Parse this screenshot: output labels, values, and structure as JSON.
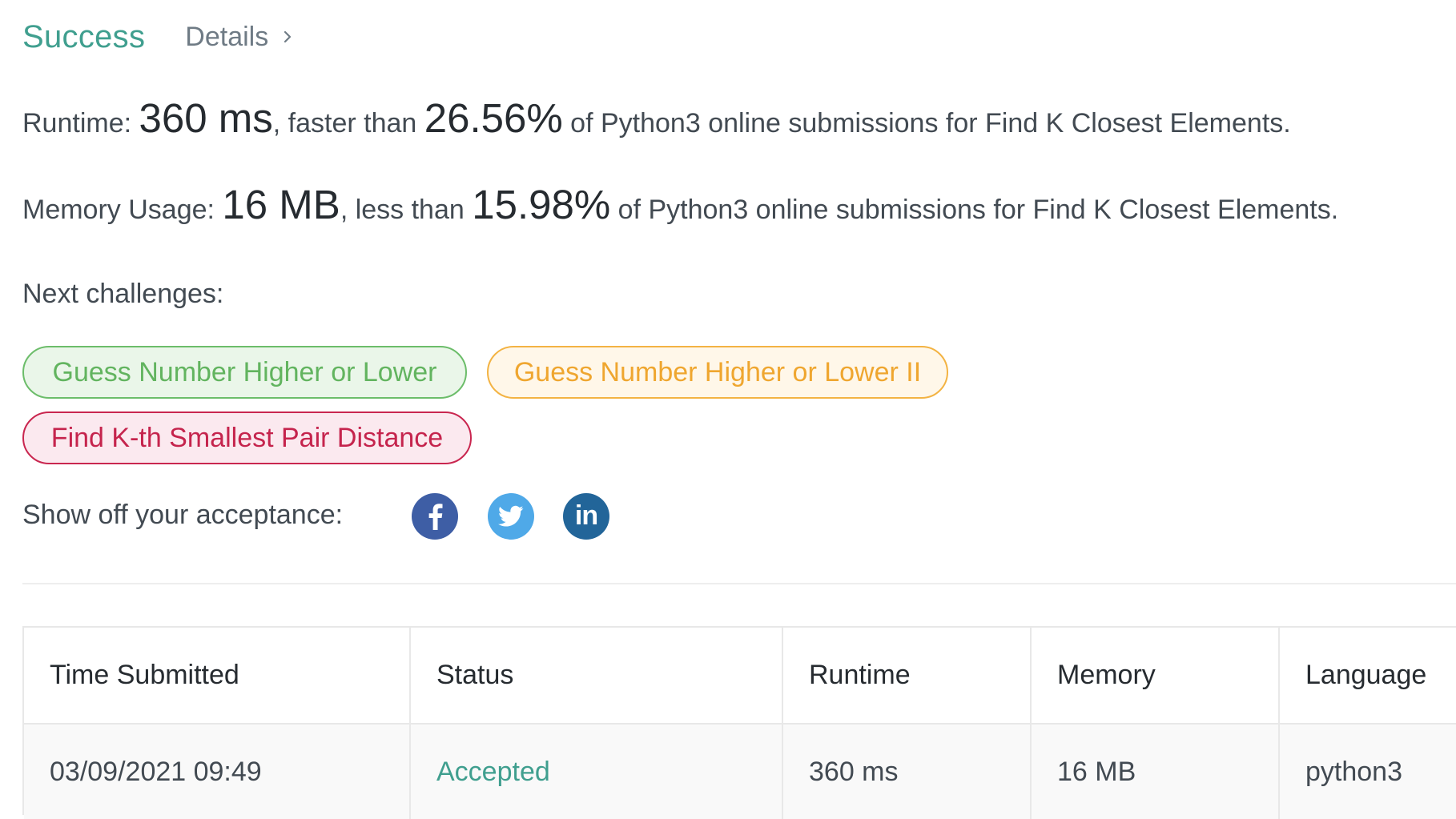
{
  "header": {
    "status": "Success",
    "details_label": "Details"
  },
  "runtime": {
    "label": "Runtime: ",
    "value": "360 ms",
    "comparison": ", faster than ",
    "percent": "26.56%",
    "suffix": " of Python3 online submissions for Find K Closest Elements."
  },
  "memory": {
    "label": "Memory Usage: ",
    "value": "16 MB",
    "comparison": ", less than ",
    "percent": "15.98%",
    "suffix": " of Python3 online submissions for Find K Closest Elements."
  },
  "next": {
    "title": "Next challenges:",
    "challenges": [
      {
        "label": "Guess Number Higher or Lower",
        "difficulty": "easy",
        "color": "#62b45f"
      },
      {
        "label": "Guess Number Higher or Lower II",
        "difficulty": "medium",
        "color": "#efa62f"
      },
      {
        "label": "Find K-th Smallest Pair Distance",
        "difficulty": "hard",
        "color": "#c5244d"
      }
    ]
  },
  "share": {
    "label": "Show off your acceptance:",
    "icons": [
      "facebook-icon",
      "twitter-icon",
      "linkedin-icon"
    ],
    "linkedin_glyph": "in"
  },
  "table": {
    "headers": [
      "Time Submitted",
      "Status",
      "Runtime",
      "Memory",
      "Language"
    ],
    "rows": [
      [
        "03/09/2021 09:49",
        "Accepted",
        "360 ms",
        "16 MB",
        "python3"
      ]
    ]
  },
  "colors": {
    "success": "#409f8f",
    "easy": "#62b45f",
    "medium": "#efa62f",
    "hard": "#c5244d",
    "facebook": "#3e5ea5",
    "twitter": "#4fa9e8",
    "linkedin": "#226599"
  }
}
